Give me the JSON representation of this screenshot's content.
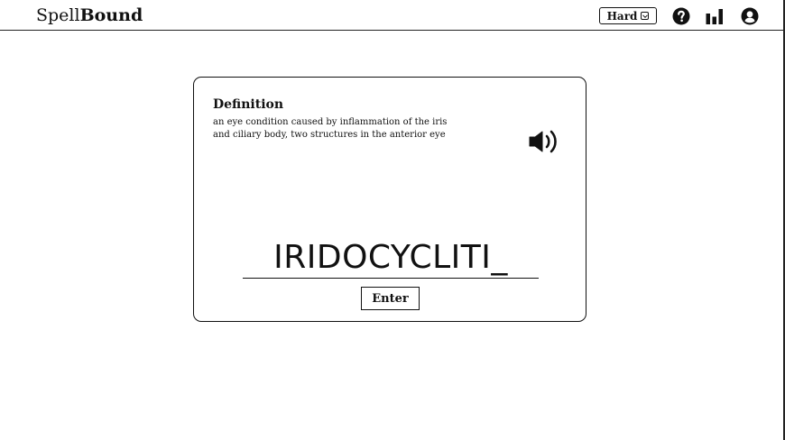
{
  "header": {
    "brand_light": "Spell",
    "brand_bold": "Bound",
    "difficulty": "Hard",
    "icons": [
      "help-icon",
      "stats-icon",
      "profile-icon"
    ]
  },
  "card": {
    "definition_title": "Definition",
    "definition_text": "an eye condition caused by inflammation of the iris and ciliary body, two structures in the anterior eye",
    "speaker_icon": "speaker-icon",
    "word_input": "IRIDOCYCLITI_",
    "enter_label": "Enter"
  }
}
